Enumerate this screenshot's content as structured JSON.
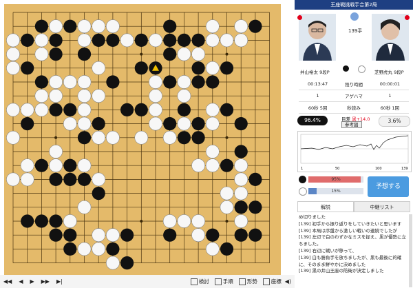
{
  "board": {
    "size": 19,
    "black": [
      [
        2,
        1
      ],
      [
        4,
        1
      ],
      [
        17,
        1
      ],
      [
        11,
        1
      ],
      [
        1,
        2
      ],
      [
        3,
        2
      ],
      [
        6,
        2
      ],
      [
        7,
        2
      ],
      [
        9,
        2
      ],
      [
        11,
        2
      ],
      [
        12,
        2
      ],
      [
        13,
        2
      ],
      [
        3,
        3
      ],
      [
        5,
        3
      ],
      [
        11,
        3
      ],
      [
        1,
        4
      ],
      [
        9,
        4
      ],
      [
        13,
        4
      ],
      [
        15,
        4
      ],
      [
        2,
        5
      ],
      [
        7,
        5
      ],
      [
        11,
        5
      ],
      [
        13,
        5
      ],
      [
        14,
        5
      ],
      [
        3,
        7
      ],
      [
        4,
        7
      ],
      [
        8,
        7
      ],
      [
        9,
        7
      ],
      [
        12,
        7
      ],
      [
        15,
        7
      ],
      [
        1,
        8
      ],
      [
        13,
        8
      ],
      [
        16,
        8
      ],
      [
        16,
        10
      ],
      [
        15,
        11
      ],
      [
        2,
        11
      ],
      [
        4,
        11
      ],
      [
        3,
        12
      ],
      [
        4,
        12
      ],
      [
        5,
        12
      ],
      [
        17,
        12
      ],
      [
        6,
        13
      ],
      [
        16,
        14
      ],
      [
        17,
        14
      ],
      [
        1,
        15
      ],
      [
        2,
        15
      ],
      [
        3,
        15
      ],
      [
        3,
        16
      ],
      [
        4,
        16
      ],
      [
        16,
        16
      ],
      [
        8,
        16
      ],
      [
        11,
        16
      ],
      [
        14,
        16
      ],
      [
        17,
        16
      ],
      [
        4,
        17
      ],
      [
        7,
        17
      ],
      [
        15,
        17
      ],
      [
        8,
        18
      ],
      [
        5,
        9
      ],
      [
        12,
        9
      ],
      [
        11,
        8
      ],
      [
        6,
        8
      ],
      [
        13,
        9
      ]
    ],
    "white": [
      [
        3,
        1
      ],
      [
        5,
        1
      ],
      [
        6,
        1
      ],
      [
        7,
        1
      ],
      [
        14,
        1
      ],
      [
        16,
        1
      ],
      [
        0,
        2
      ],
      [
        2,
        2
      ],
      [
        5,
        2
      ],
      [
        8,
        2
      ],
      [
        10,
        2
      ],
      [
        14,
        2
      ],
      [
        15,
        2
      ],
      [
        16,
        2
      ],
      [
        0,
        3
      ],
      [
        2,
        3
      ],
      [
        12,
        3
      ],
      [
        13,
        3
      ],
      [
        0,
        4
      ],
      [
        14,
        4
      ],
      [
        3,
        5
      ],
      [
        4,
        5
      ],
      [
        5,
        5
      ],
      [
        10,
        5
      ],
      [
        12,
        5
      ],
      [
        2,
        6
      ],
      [
        3,
        6
      ],
      [
        5,
        6
      ],
      [
        6,
        6
      ],
      [
        10,
        6
      ],
      [
        12,
        6
      ],
      [
        0,
        7
      ],
      [
        1,
        7
      ],
      [
        2,
        7
      ],
      [
        5,
        7
      ],
      [
        10,
        7
      ],
      [
        14,
        7
      ],
      [
        4,
        8
      ],
      [
        5,
        8
      ],
      [
        10,
        8
      ],
      [
        14,
        8
      ],
      [
        0,
        9
      ],
      [
        6,
        9
      ],
      [
        7,
        9
      ],
      [
        9,
        9
      ],
      [
        11,
        9
      ],
      [
        3,
        10
      ],
      [
        14,
        10
      ],
      [
        1,
        11
      ],
      [
        3,
        11
      ],
      [
        5,
        11
      ],
      [
        13,
        11
      ],
      [
        14,
        11
      ],
      [
        16,
        11
      ],
      [
        0,
        12
      ],
      [
        1,
        12
      ],
      [
        6,
        12
      ],
      [
        16,
        12
      ],
      [
        16,
        13
      ],
      [
        5,
        14
      ],
      [
        15,
        14
      ],
      [
        4,
        15
      ],
      [
        16,
        15
      ],
      [
        6,
        16
      ],
      [
        7,
        16
      ],
      [
        13,
        16
      ],
      [
        5,
        17
      ],
      [
        6,
        17
      ],
      [
        14,
        17
      ],
      [
        7,
        18
      ],
      [
        12,
        15
      ],
      [
        13,
        15
      ],
      [
        11,
        15
      ],
      [
        12,
        8
      ],
      [
        15,
        13
      ],
      [
        6,
        4
      ]
    ],
    "last_move": [
      10,
      4
    ]
  },
  "controls": {
    "nav": [
      "◀◀",
      "◀",
      "▶",
      "▶▶",
      "▶|"
    ],
    "review": "検討",
    "order": "手順",
    "influence": "形勢",
    "coords": "座標",
    "sound_icon": "speaker-icon"
  },
  "game_title": "王座戦挑戦手合第2局",
  "move_label": "139手",
  "black_player": "井山裕太 9段P",
  "white_player": "芝野虎丸 9段P",
  "time": {
    "black_elapsed": "00:13:47",
    "header": "残り時間",
    "white_elapsed": "00:00:01",
    "black_count": "1",
    "mid_label": "アゲハマ",
    "white_count": "1",
    "black_byoyomi": "60秒 5回",
    "byoyomi_label": "秒読み",
    "white_byoyomi": "60秒 1回"
  },
  "winrate": {
    "black": "96.4%",
    "white": "3.6%",
    "diff_label": "目差",
    "diff_value": "黒+14.0",
    "ref_label": "参考図"
  },
  "graph": {
    "x_ticks": [
      "1",
      "50",
      "100",
      "139"
    ]
  },
  "prediction": {
    "red_pct": 0.95,
    "red_label": "95%",
    "blue_pct": 0.15,
    "blue_label": "15%",
    "button": "予想する"
  },
  "tabs": [
    "解説",
    "中継リスト"
  ],
  "comment": [
    "め切りました",
    "[139] 初手から振り返りをしていきたいと思います",
    "[139] 本局は序盤から激しい戦いの連続でしたが",
    "[139] 左辺で白のわずかなミスを捉え、黒が優勢に立ちました。",
    "[139] 右辺に戦いが移って、",
    "[139] 白も勝負手を放ちましたが、黒も最後に的確に、そのまま鮮やかに決めました",
    "[139] 黒の井山王座の防衛が決定しました"
  ],
  "colors": {
    "accent": "#1e3f82",
    "board": "#e4ba6a",
    "red": "#e2001a",
    "predict": "#4b9be0"
  }
}
